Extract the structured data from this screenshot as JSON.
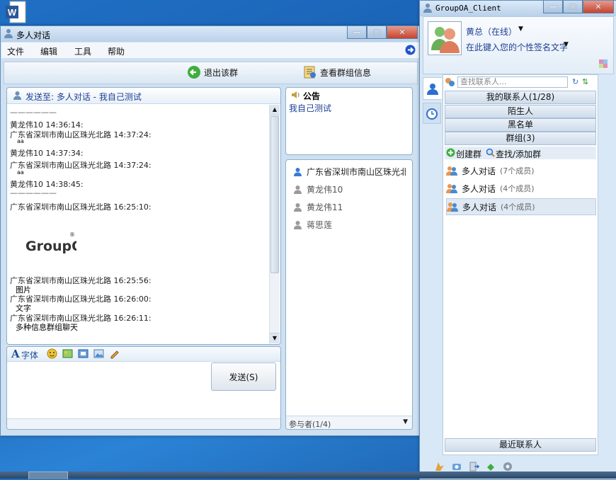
{
  "chat_window": {
    "title": "多人对话",
    "menu": [
      "文件",
      "编辑",
      "工具",
      "帮助"
    ],
    "toolbar": {
      "exit_group": "退出该群",
      "view_group_info": "查看群组信息"
    },
    "send_to": "发送至: 多人对话 - 我自己测试",
    "messages": [
      {
        "type": "sep",
        "text": "——————"
      },
      {
        "type": "header",
        "text": "黄龙伟10 14:36:14:"
      },
      {
        "type": "header",
        "text": "广东省深圳市南山区珠光北路 14:37:24:"
      },
      {
        "type": "body",
        "text": "aa"
      },
      {
        "type": "header",
        "text": "黄龙伟10 14:37:34:"
      },
      {
        "type": "header",
        "text": "广东省深圳市南山区珠光北路 14:37:24:"
      },
      {
        "type": "body",
        "text": "aa"
      },
      {
        "type": "header",
        "text": "黄龙伟10 14:38:45:"
      },
      {
        "type": "sep",
        "text": "——————"
      },
      {
        "type": "header",
        "text": "广东省深圳市南山区珠光北路 16:25:10:"
      },
      {
        "type": "header",
        "text": "广东省深圳市南山区珠光北路 16:25:56:"
      },
      {
        "type": "body",
        "text": "图片"
      },
      {
        "type": "header",
        "text": "广东省深圳市南山区珠光北路 16:26:00:"
      },
      {
        "type": "body",
        "text": "文字"
      },
      {
        "type": "header",
        "text": "广东省深圳市南山区珠光北路 16:26:11:"
      },
      {
        "type": "body",
        "text": "多种信息群组聊天"
      }
    ],
    "image_logo": "GroupOA",
    "font_label": "字体",
    "send_button": "发送(S)",
    "notice": {
      "title": "公告",
      "text": "我自己测试"
    },
    "members": [
      {
        "name": "广东省深圳市南山区珠光北路",
        "online": true
      },
      {
        "name": "黄龙伟10",
        "online": false
      },
      {
        "name": "黄龙伟11",
        "online": false
      },
      {
        "name": "蒋思莲",
        "online": false
      }
    ],
    "participants": "参与者(1/4)"
  },
  "client_window": {
    "title": "GroupOA_Client",
    "user": {
      "name": "黄总（在线）",
      "signature": "在此键入您的个性签名文字"
    },
    "search_placeholder": "查找联系人...",
    "groups": {
      "my_contacts": "我的联系人(1/28)",
      "strangers": "陌生人",
      "blacklist": "黑名单",
      "groups_header": "群组(3)",
      "recent": "最近联系人"
    },
    "actions": {
      "create_group": "创建群",
      "find_group": "查找/添加群"
    },
    "group_list": [
      {
        "name": "多人对话",
        "count": "(7个成员)"
      },
      {
        "name": "多人对话",
        "count": "(4个成员)"
      },
      {
        "name": "多人对话",
        "count": "(4个成员)",
        "selected": true
      }
    ]
  },
  "colors": {
    "accent": "#1a5fb0",
    "link": "#1c3f95",
    "online": "#3a7bd5"
  }
}
